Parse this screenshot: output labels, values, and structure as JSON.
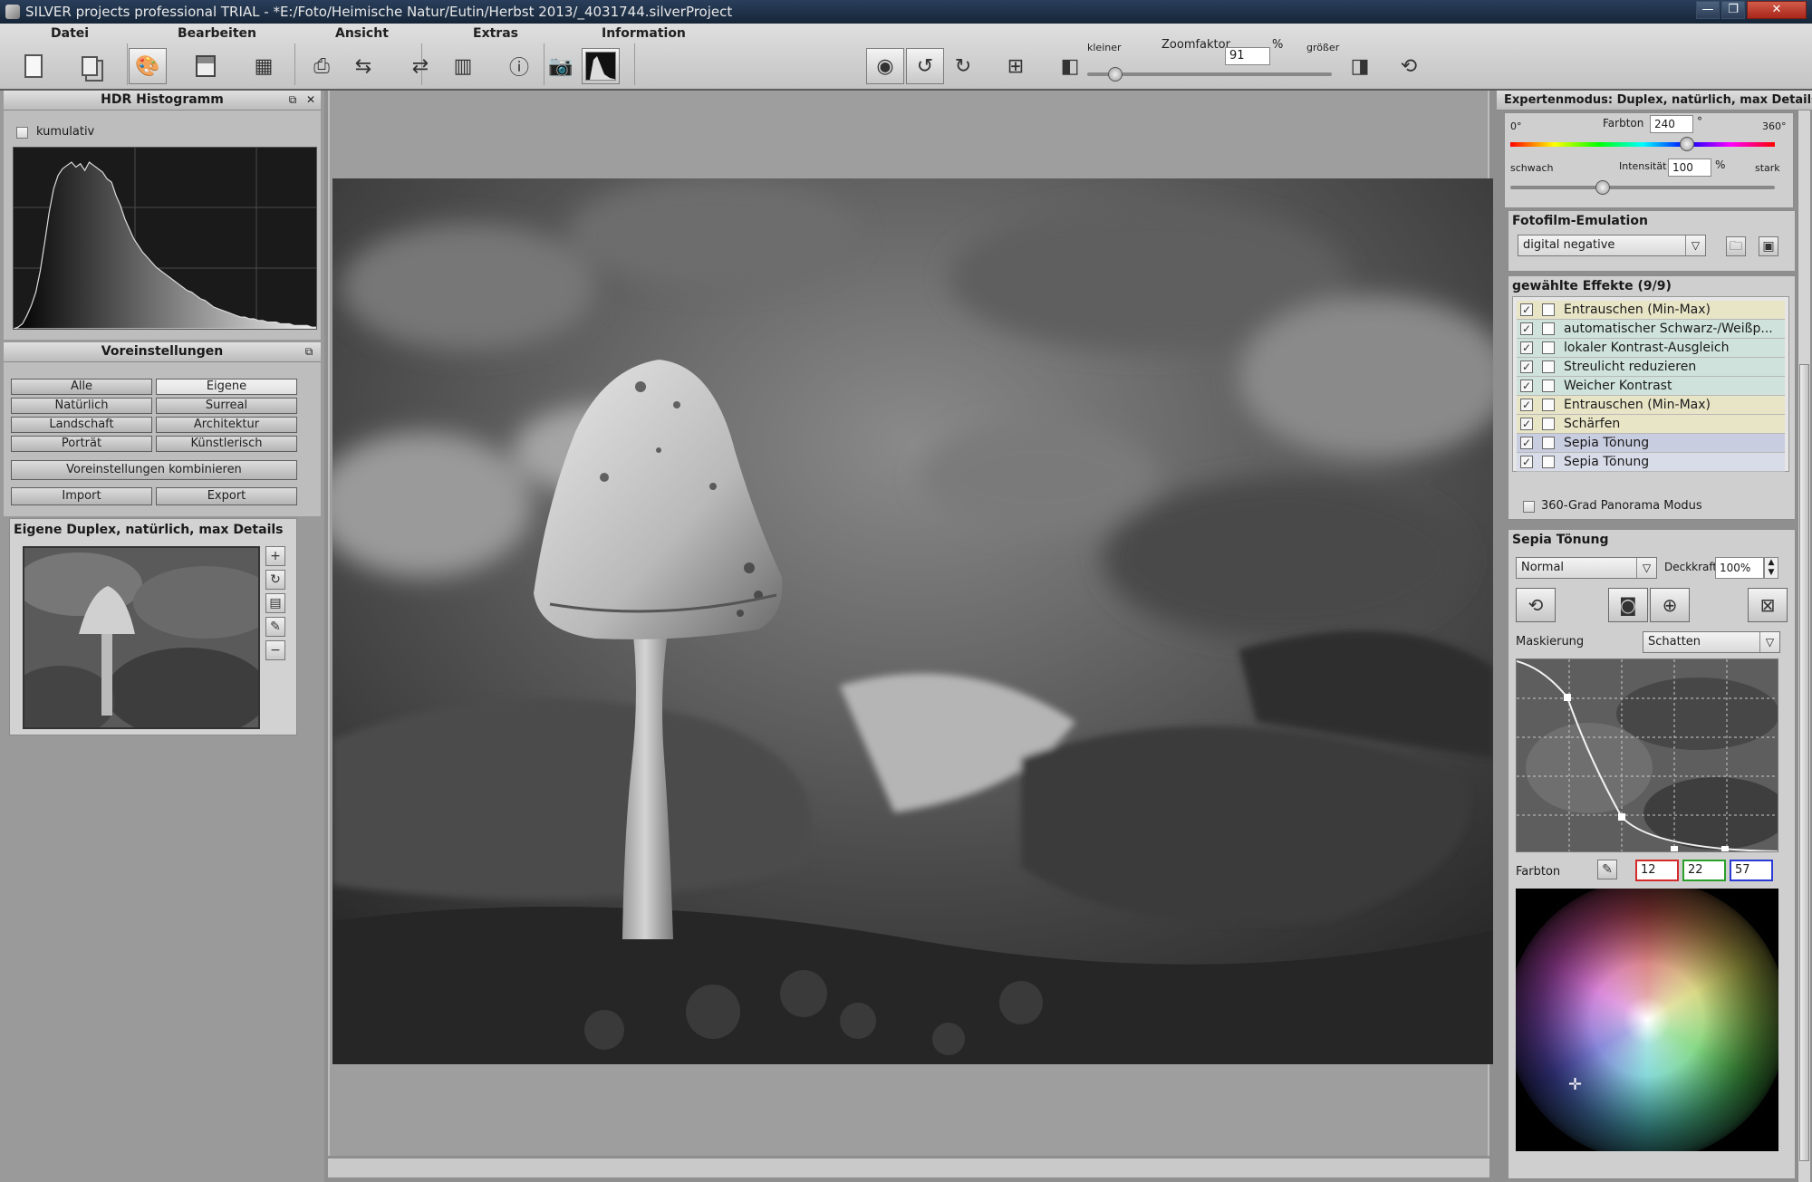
{
  "window": {
    "title": "SILVER projects professional  TRIAL - *E:/Foto/Heimische Natur/Eutin/Herbst 2013/_4031744.silverProject",
    "min_glyph": "—",
    "max_glyph": "❐",
    "close_glyph": "✕"
  },
  "menu": [
    "Datei",
    "Bearbeiten",
    "Ansicht",
    "Extras",
    "Information"
  ],
  "toolbar": {
    "zoom_smaller_label": "kleiner",
    "zoom_factor_label": "Zoomfaktor",
    "zoom_value": "91",
    "zoom_unit": "%",
    "zoom_bigger_label": "größer"
  },
  "histogram_panel": {
    "title": "HDR Histogramm",
    "cumulative_label": "kumulativ",
    "curve": [
      0,
      1,
      3,
      8,
      14,
      22,
      35,
      52,
      70,
      84,
      92,
      96,
      98,
      100,
      97,
      99,
      95,
      100,
      98,
      96,
      94,
      90,
      88,
      80,
      74,
      66,
      60,
      54,
      50,
      46,
      43,
      40,
      37,
      35,
      33,
      31,
      29,
      27,
      25,
      23,
      22,
      20,
      18,
      17,
      15,
      13,
      12,
      11,
      10,
      9,
      8,
      7,
      7,
      6,
      6,
      5,
      5,
      4,
      4,
      4,
      3,
      3,
      3,
      2,
      2,
      2,
      2,
      1,
      1
    ]
  },
  "presets_panel": {
    "title": "Voreinstellungen",
    "buttons": [
      [
        "Alle",
        "Eigene"
      ],
      [
        "Natürlich",
        "Surreal"
      ],
      [
        "Landschaft",
        "Architektur"
      ],
      [
        "Porträt",
        "Künstlerisch"
      ]
    ],
    "combine_label": "Voreinstellungen kombinieren",
    "import_label": "Import",
    "export_label": "Export",
    "selected": "Eigene"
  },
  "preview": {
    "title": "Eigene Duplex, natürlich, max Details"
  },
  "expert": {
    "title": "Expertenmodus: Duplex, natürlich, max Details",
    "hue_label": "Farbton",
    "hue_value": "240",
    "hue_unit": "°",
    "hue_min": "0°",
    "hue_max": "360°",
    "hue_fraction": 0.667,
    "weak_label": "schwach",
    "intensity_label": "Intensität",
    "intensity_value": "100",
    "intensity_unit": "%",
    "strong_label": "stark",
    "intensity_fraction": 0.35
  },
  "film": {
    "title": "Fotofilm-Emulation",
    "selected": "digital negative"
  },
  "effects": {
    "title": "gewählte Effekte (9/9)",
    "items": [
      {
        "label": "Entrauschen (Min-Max)",
        "color": "#e8e4c6"
      },
      {
        "label": "automatischer Schwarz-/Weißp...",
        "color": "#cfe3dc"
      },
      {
        "label": "lokaler Kontrast-Ausgleich",
        "color": "#cfe3dc"
      },
      {
        "label": "Streulicht reduzieren",
        "color": "#cfe3dc"
      },
      {
        "label": "Weicher Kontrast",
        "color": "#cfe3dc"
      },
      {
        "label": "Entrauschen (Min-Max)",
        "color": "#e8e4c6"
      },
      {
        "label": "Schärfen",
        "color": "#e8e4c6"
      },
      {
        "label": "Sepia Tönung",
        "color": "#c9cde0"
      },
      {
        "label": "Sepia Tönung",
        "color": "#d8dbe8"
      }
    ],
    "panorama_label": "360-Grad Panorama Modus"
  },
  "sepia": {
    "title": "Sepia Tönung",
    "blend_mode": "Normal",
    "opacity_label": "Deckkraft",
    "opacity_value": "100%",
    "mask_label": "Maskierung",
    "mask_mode": "Schatten",
    "hue_label": "Farbton",
    "r": "12",
    "g": "22",
    "b": "57",
    "r_color": "#d42a2a",
    "g_color": "#2aa02a",
    "b_color": "#2a3ad4"
  }
}
